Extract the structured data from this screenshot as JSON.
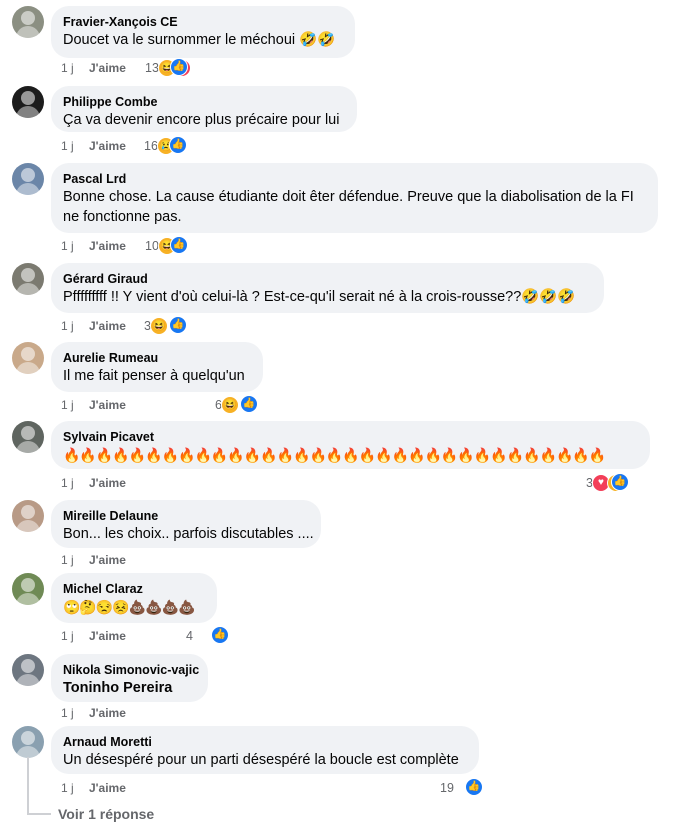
{
  "comments": [
    {
      "author": "Fravier-Xançois CE",
      "text": "Doucet va le surnommer le méchoui 🤣🤣",
      "time": "1 j",
      "like": "J'aime",
      "reaction_count": "13",
      "reactions": [
        "like-icon",
        "laughing-icon",
        "heart-icon"
      ],
      "avatar_color": "#8b8f82"
    },
    {
      "author": "Philippe Combe",
      "text": "Ça va devenir encore plus précaire pour lui",
      "time": "1 j",
      "like": "J'aime",
      "reaction_count": "16",
      "reactions": [
        "like-icon",
        "sad-icon"
      ],
      "avatar_color": "#1c1c1c"
    },
    {
      "author": "Pascal Lrd",
      "text": "Bonne chose. La cause étudiante doit êter défendue. Preuve que la diabolisation de la FI ne fonctionne pas.",
      "time": "1 j",
      "like": "J'aime",
      "reaction_count": "10",
      "reactions": [
        "like-icon",
        "laughing-icon"
      ],
      "avatar_color": "#6b86a8"
    },
    {
      "author": "Gérard Giraud",
      "text": "Pfffffffff !! Y vient d'où celui-là ? Est-ce-qu'il serait né à la crois-rousse??🤣🤣🤣",
      "time": "1 j",
      "like": "J'aime",
      "reaction_count": "3",
      "reactions": [
        "like-icon",
        "laughing-icon"
      ],
      "avatar_color": "#7b7a70"
    },
    {
      "author": "Aurelie Rumeau",
      "text": "Il me fait penser à quelqu'un",
      "time": "1 j",
      "like": "J'aime",
      "reaction_count": "6",
      "reactions": [
        "like-icon",
        "laughing-icon"
      ],
      "avatar_color": "#c9a98a"
    },
    {
      "author": "Sylvain Picavet",
      "text": "🔥🔥🔥🔥🔥🔥🔥🔥🔥🔥🔥🔥🔥🔥🔥🔥🔥🔥🔥🔥🔥🔥🔥🔥🔥🔥🔥🔥🔥🔥🔥🔥🔥",
      "time": "1 j",
      "like": "J'aime",
      "reaction_count": "3",
      "reactions": [
        "like-icon",
        "heart-icon",
        "laughing-icon"
      ],
      "avatar_color": "#5f6560"
    },
    {
      "author": "Mireille Delaune",
      "text": "Bon... les choix.. parfois discutables ....",
      "time": "1 j",
      "like": "J'aime",
      "reaction_count": "",
      "reactions": [],
      "avatar_color": "#b89a86"
    },
    {
      "author": "Michel Claraz",
      "text": "🙄🤔😒😣💩💩💩💩",
      "time": "1 j",
      "like": "J'aime",
      "reaction_count": "4",
      "reactions": [
        "like-icon"
      ],
      "avatar_color": "#6f8a55"
    },
    {
      "author": "Nikola Simonovic-vajic",
      "text": "Toninho Pereira",
      "time": "1 j",
      "like": "J'aime",
      "reaction_count": "",
      "reactions": [],
      "avatar_color": "#6d7680"
    },
    {
      "author": "Arnaud Moretti",
      "text": "Un désespéré pour un parti désespéré la boucle est complète",
      "time": "1 j",
      "like": "J'aime",
      "reaction_count": "19",
      "reactions": [
        "like-icon"
      ],
      "avatar_color": "#8aa0b0"
    }
  ],
  "view_replies": "Voir 1 réponse",
  "colors": {
    "bubble": "#f0f2f5",
    "meta_text": "#65676b",
    "like_blue": "#1877f2",
    "love_red": "#f33e58",
    "emoji_yellow": "#f7b125"
  }
}
